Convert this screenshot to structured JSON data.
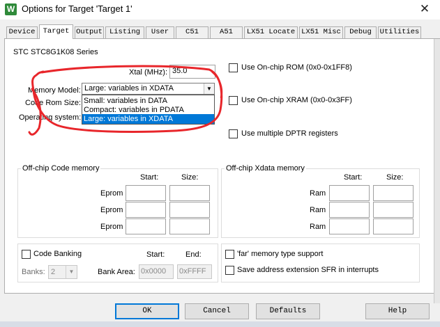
{
  "window": {
    "title": "Options for Target 'Target 1'",
    "icon_letter": "W",
    "icon": "keil-icon",
    "close_glyph": "✕"
  },
  "tabs": [
    "Device",
    "Target",
    "Output",
    "Listing",
    "User",
    "C51",
    "A51",
    "LX51 Locate",
    "LX51 Misc",
    "Debug",
    "Utilities"
  ],
  "active_tab": "Target",
  "device_name": "STC STC8G1K08 Series",
  "xtal": {
    "label": "Xtal (MHz):",
    "value": "35.0"
  },
  "memory_model": {
    "label": "Memory Model:",
    "value": "Large: variables in XDATA",
    "options": [
      "Small: variables in DATA",
      "Compact: variables in PDATA",
      "Large: variables in XDATA"
    ],
    "selected_index": 2
  },
  "code_rom_size_label": "Code Rom Size:",
  "operating_system_label": "Operating system:",
  "checkboxes_right": [
    {
      "label": "Use On-chip ROM (0x0-0x1FF8)",
      "checked": false
    },
    {
      "label": "Use On-chip XRAM (0x0-0x3FF)",
      "checked": false
    },
    {
      "label": "Use multiple DPTR registers",
      "checked": false
    }
  ],
  "offchip_code": {
    "title": "Off-chip Code memory",
    "start_header": "Start:",
    "size_header": "Size:",
    "rows": [
      "Eprom",
      "Eprom",
      "Eprom"
    ]
  },
  "offchip_xdata": {
    "title": "Off-chip Xdata memory",
    "start_header": "Start:",
    "size_header": "Size:",
    "rows": [
      "Ram",
      "Ram",
      "Ram"
    ]
  },
  "banking": {
    "code_banking_label": "Code Banking",
    "start_header": "Start:",
    "end_header": "End:",
    "banks_label": "Banks:",
    "banks_value": "2",
    "bank_area_label": "Bank Area:",
    "start_value": "0x0000",
    "end_value": "0xFFFF"
  },
  "far_options": [
    {
      "label": "'far' memory type support",
      "checked": false
    },
    {
      "label": "Save address extension SFR in interrupts",
      "checked": false
    }
  ],
  "buttons": {
    "ok": "OK",
    "cancel": "Cancel",
    "defaults": "Defaults",
    "help": "Help"
  },
  "annotation_color": "#e8262b"
}
